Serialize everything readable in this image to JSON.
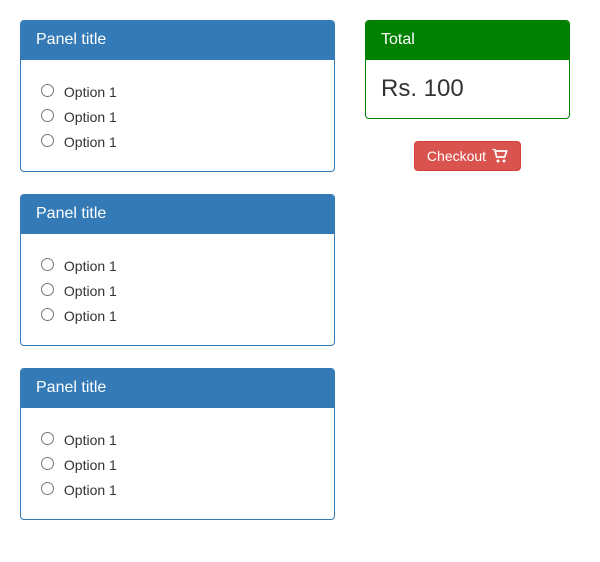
{
  "panels": [
    {
      "title": "Panel title",
      "options": [
        "Option 1",
        "Option 1",
        "Option 1"
      ]
    },
    {
      "title": "Panel title",
      "options": [
        "Option 1",
        "Option 1",
        "Option 1"
      ]
    },
    {
      "title": "Panel title",
      "options": [
        "Option 1",
        "Option 1",
        "Option 1"
      ]
    }
  ],
  "total": {
    "title": "Total",
    "amount": "Rs. 100"
  },
  "checkout": {
    "label": "Checkout"
  }
}
